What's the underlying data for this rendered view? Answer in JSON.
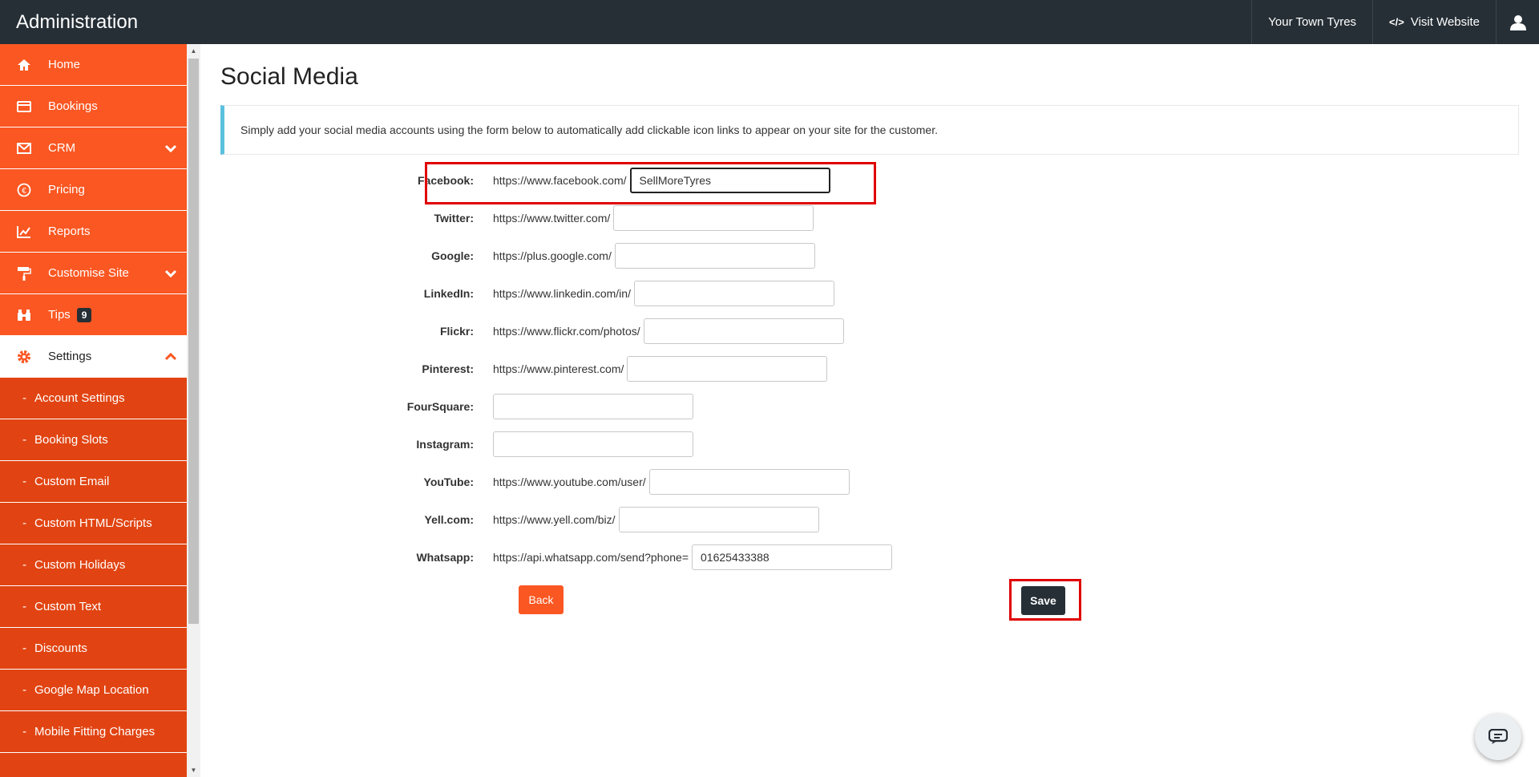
{
  "header": {
    "title": "Administration",
    "business_name": "Your Town Tyres",
    "visit_website": "Visit Website"
  },
  "sidebar": {
    "items": [
      {
        "label": "Home",
        "icon": "home-icon"
      },
      {
        "label": "Bookings",
        "icon": "card-icon"
      },
      {
        "label": "CRM",
        "icon": "envelope-icon"
      },
      {
        "label": "Pricing",
        "icon": "euro-icon"
      },
      {
        "label": "Reports",
        "icon": "chart-icon"
      },
      {
        "label": "Customise Site",
        "icon": "paint-roller-icon"
      },
      {
        "label": "Tips",
        "icon": "binoculars-icon",
        "badge": "9"
      },
      {
        "label": "Settings",
        "icon": "gear-icon"
      }
    ],
    "settings_sub": [
      "Account Settings",
      "Booking Slots",
      "Custom Email",
      "Custom HTML/Scripts",
      "Custom Holidays",
      "Custom Text",
      "Discounts",
      "Google Map Location",
      "Mobile Fitting Charges"
    ]
  },
  "page": {
    "title": "Social Media",
    "info": "Simply add your social media accounts using the form below to automatically add clickable icon links to appear on your site for the customer."
  },
  "form": {
    "fields": [
      {
        "label": "Facebook:",
        "prefix": "https://www.facebook.com/",
        "value": "SellMoreTyres"
      },
      {
        "label": "Twitter:",
        "prefix": "https://www.twitter.com/",
        "value": ""
      },
      {
        "label": "Google:",
        "prefix": "https://plus.google.com/",
        "value": ""
      },
      {
        "label": "LinkedIn:",
        "prefix": "https://www.linkedin.com/in/",
        "value": ""
      },
      {
        "label": "Flickr:",
        "prefix": "https://www.flickr.com/photos/",
        "value": ""
      },
      {
        "label": "Pinterest:",
        "prefix": "https://www.pinterest.com/",
        "value": ""
      },
      {
        "label": "FourSquare:",
        "prefix": "",
        "value": ""
      },
      {
        "label": "Instagram:",
        "prefix": "",
        "value": ""
      },
      {
        "label": "YouTube:",
        "prefix": "https://www.youtube.com/user/",
        "value": ""
      },
      {
        "label": "Yell.com:",
        "prefix": "https://www.yell.com/biz/",
        "value": ""
      },
      {
        "label": "Whatsapp:",
        "prefix": "https://api.whatsapp.com/send?phone=",
        "value": "01625433388"
      }
    ],
    "back_label": "Back",
    "save_label": "Save"
  },
  "colors": {
    "accent": "#fa5722",
    "accent_dark": "#e14412",
    "topbar": "#262f36",
    "highlight": "#e00000",
    "info_border": "#5bc0de"
  }
}
